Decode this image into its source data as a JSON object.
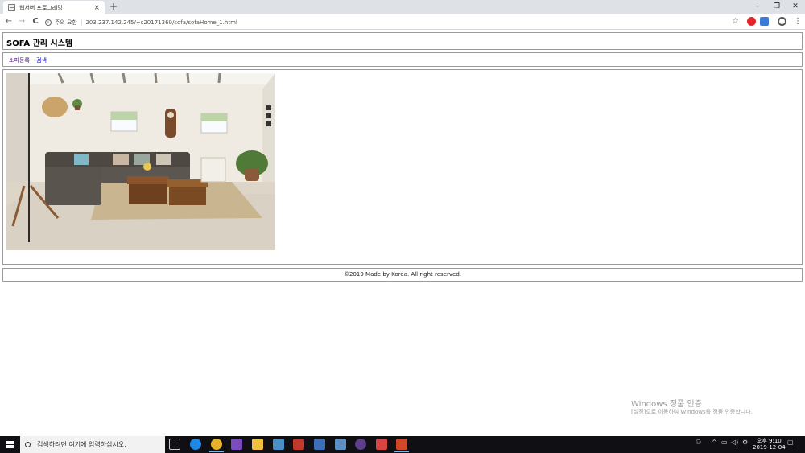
{
  "browser": {
    "tab_title": "웹서버 프로그래밍",
    "tab_close": "×",
    "new_tab": "+",
    "minimize": "–",
    "restore": "❐",
    "close": "✕",
    "back": "←",
    "forward": "→",
    "reload": "C",
    "security_label": "주의 요함",
    "url": "203.237.142.245/~s20171360/sofa/sofaHome_1.html",
    "bookmark": "☆",
    "menu": "⋮"
  },
  "page": {
    "title": "SOFA 관리 시스템",
    "nav": [
      {
        "label": "소파등록"
      },
      {
        "label": "검색"
      }
    ],
    "footer": "©2019 Made by Korea. All right reserved."
  },
  "watermark": {
    "line1": "Windows 정품 인증",
    "line2": "[설정]으로 이동하여 Windows를 정품 인증합니다."
  },
  "taskbar": {
    "search_placeholder": "검색하려면 여기에 입력하십시오.",
    "ampm_time": "오후 9:10",
    "date": "2019-12-04",
    "apps": [
      "task-view",
      "edge",
      "chrome",
      "visual-studio",
      "file-explorer",
      "store",
      "filezilla",
      "network-app",
      "notepad",
      "media-app",
      "paint-app",
      "powerpoint"
    ]
  }
}
